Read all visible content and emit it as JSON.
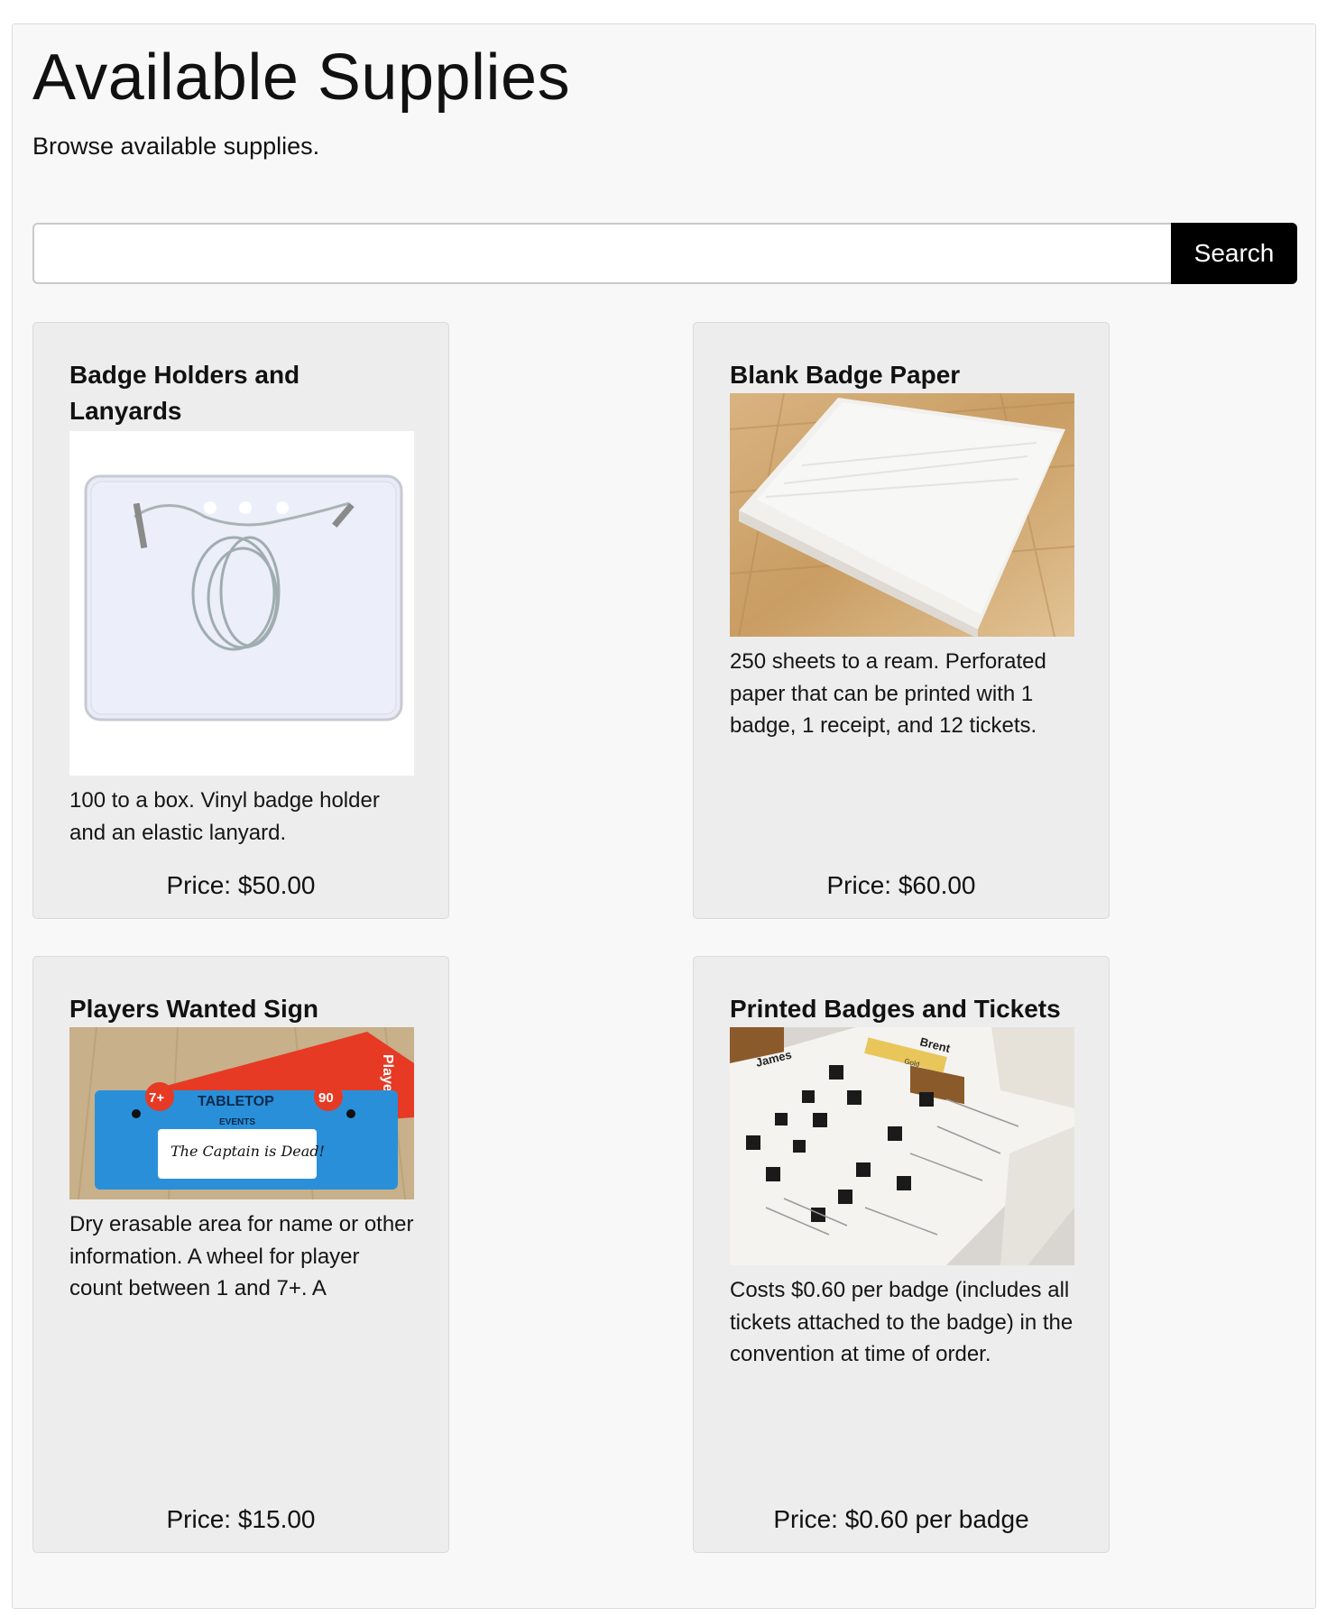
{
  "page": {
    "title": "Available Supplies",
    "subtitle": "Browse available supplies."
  },
  "search": {
    "placeholder": "",
    "value": "",
    "button_label": "Search"
  },
  "supplies": [
    {
      "title": "Badge Holders and Lanyards",
      "description": "100 to a box. Vinyl badge holder and an elastic lanyard.",
      "price": "Price: $50.00"
    },
    {
      "title": "Blank Badge Paper",
      "description": "250 sheets to a ream. Perforated paper that can be printed with 1 badge, 1 receipt, and 12 tickets.",
      "price": "Price: $60.00"
    },
    {
      "title": "Players Wanted Sign",
      "description": "Dry erasable area for name or other information. A wheel for player count between 1 and 7+. A",
      "price": "Price: $15.00",
      "image_text": {
        "banner": "Players Wanted",
        "brand": "TABLETOP",
        "brand_sub": "EVENTS",
        "count": "7+",
        "minutes": "90",
        "handwriting": "The Captain is Dead!"
      }
    },
    {
      "title": "Printed Badges and Tickets",
      "description": "Costs $0.60 per badge (includes all tickets attached to the badge) in the convention at time of order.",
      "price": "Price: $0.60 per badge",
      "image_text": {
        "badge_name_1": "James",
        "badge_name_2": "Brent",
        "badge_level": "Gold"
      }
    }
  ]
}
